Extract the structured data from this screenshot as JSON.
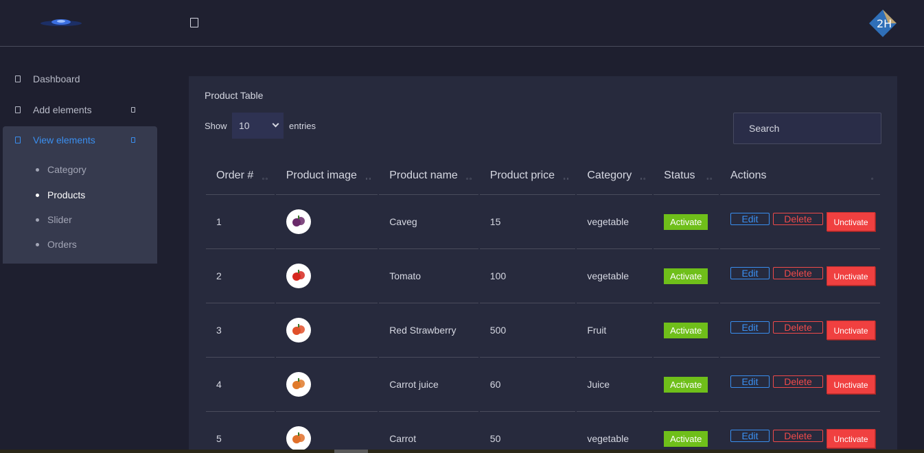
{
  "sidebar": {
    "items": [
      {
        "label": "Dashboard",
        "icon": "dashboard-icon"
      },
      {
        "label": "Add elements",
        "icon": "plus-icon"
      },
      {
        "label": "View elements",
        "icon": "eye-icon"
      }
    ],
    "subitems": [
      "Category",
      "Products",
      "Slider",
      "Orders"
    ],
    "active_subitem": "Products"
  },
  "table_card": {
    "title": "Product Table",
    "show_label": "Show",
    "entries_value": "10",
    "entries_label": "entries",
    "search_placeholder": "Search"
  },
  "table": {
    "columns": [
      "Order #",
      "Product image",
      "Product name",
      "Product price",
      "Category",
      "Status",
      "Actions"
    ],
    "rows": [
      {
        "order": "1",
        "name": "Caveg",
        "price": "15",
        "category": "vegetable",
        "status": "Activate"
      },
      {
        "order": "2",
        "name": "Tomato",
        "price": "100",
        "category": "vegetable",
        "status": "Activate"
      },
      {
        "order": "3",
        "name": "Red Strawberry",
        "price": "500",
        "category": "Fruit",
        "status": "Activate"
      },
      {
        "order": "4",
        "name": "Carrot juice",
        "price": "60",
        "category": "Juice",
        "status": "Activate"
      },
      {
        "order": "5",
        "name": "Carrot",
        "price": "50",
        "category": "vegetable",
        "status": "Activate"
      }
    ],
    "actions": {
      "edit": "Edit",
      "delete": "Delete",
      "unactivate": "Unctivate"
    }
  },
  "colors": {
    "accent": "#3a8ff0",
    "activate": "#6fbf1a",
    "danger": "#f04040",
    "background": "#1e1f2f",
    "card": "#272a3d"
  }
}
